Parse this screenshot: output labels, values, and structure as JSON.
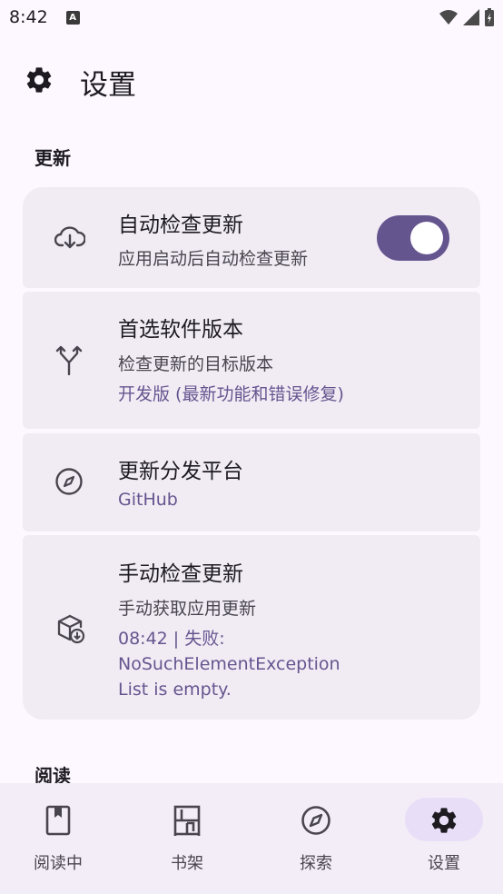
{
  "status_bar": {
    "time": "8:42",
    "notification_badge": "A",
    "icons": [
      "wifi-icon",
      "signal-icon",
      "battery-charging-icon"
    ]
  },
  "app_bar": {
    "icon": "gear-icon",
    "title": "设置"
  },
  "sections": {
    "update": {
      "header": "更新"
    },
    "reading": {
      "header": "阅读"
    }
  },
  "settings": {
    "auto_check": {
      "icon": "cloud-download-icon",
      "title": "自动检查更新",
      "subtitle": "应用启动后自动检查更新",
      "enabled": true
    },
    "preferred_version": {
      "icon": "branch-icon",
      "title": "首选软件版本",
      "subtitle": "检查更新的目标版本",
      "value": "开发版 (最新功能和错误修复)"
    },
    "distribution_platform": {
      "icon": "compass-icon",
      "title": "更新分发平台",
      "value": "GitHub"
    },
    "manual_check": {
      "icon": "package-download-icon",
      "title": "手动检查更新",
      "subtitle": "手动获取应用更新",
      "result_line1": "08:42 | 失败:",
      "result_line2": "NoSuchElementException",
      "result_line3": "List is empty."
    }
  },
  "bottom_nav": {
    "items": [
      {
        "label": "阅读中",
        "icon": "book-icon",
        "active": false
      },
      {
        "label": "书架",
        "icon": "bookshelf-icon",
        "active": false
      },
      {
        "label": "探索",
        "icon": "compass-icon",
        "active": false
      },
      {
        "label": "设置",
        "icon": "gear-icon",
        "active": true
      }
    ]
  },
  "colors": {
    "background": "#FDF7FF",
    "card": "#F1ECF4",
    "accent": "#65558F",
    "nav_background": "#F3EDF7",
    "nav_active_pill": "#E8DEF8"
  }
}
